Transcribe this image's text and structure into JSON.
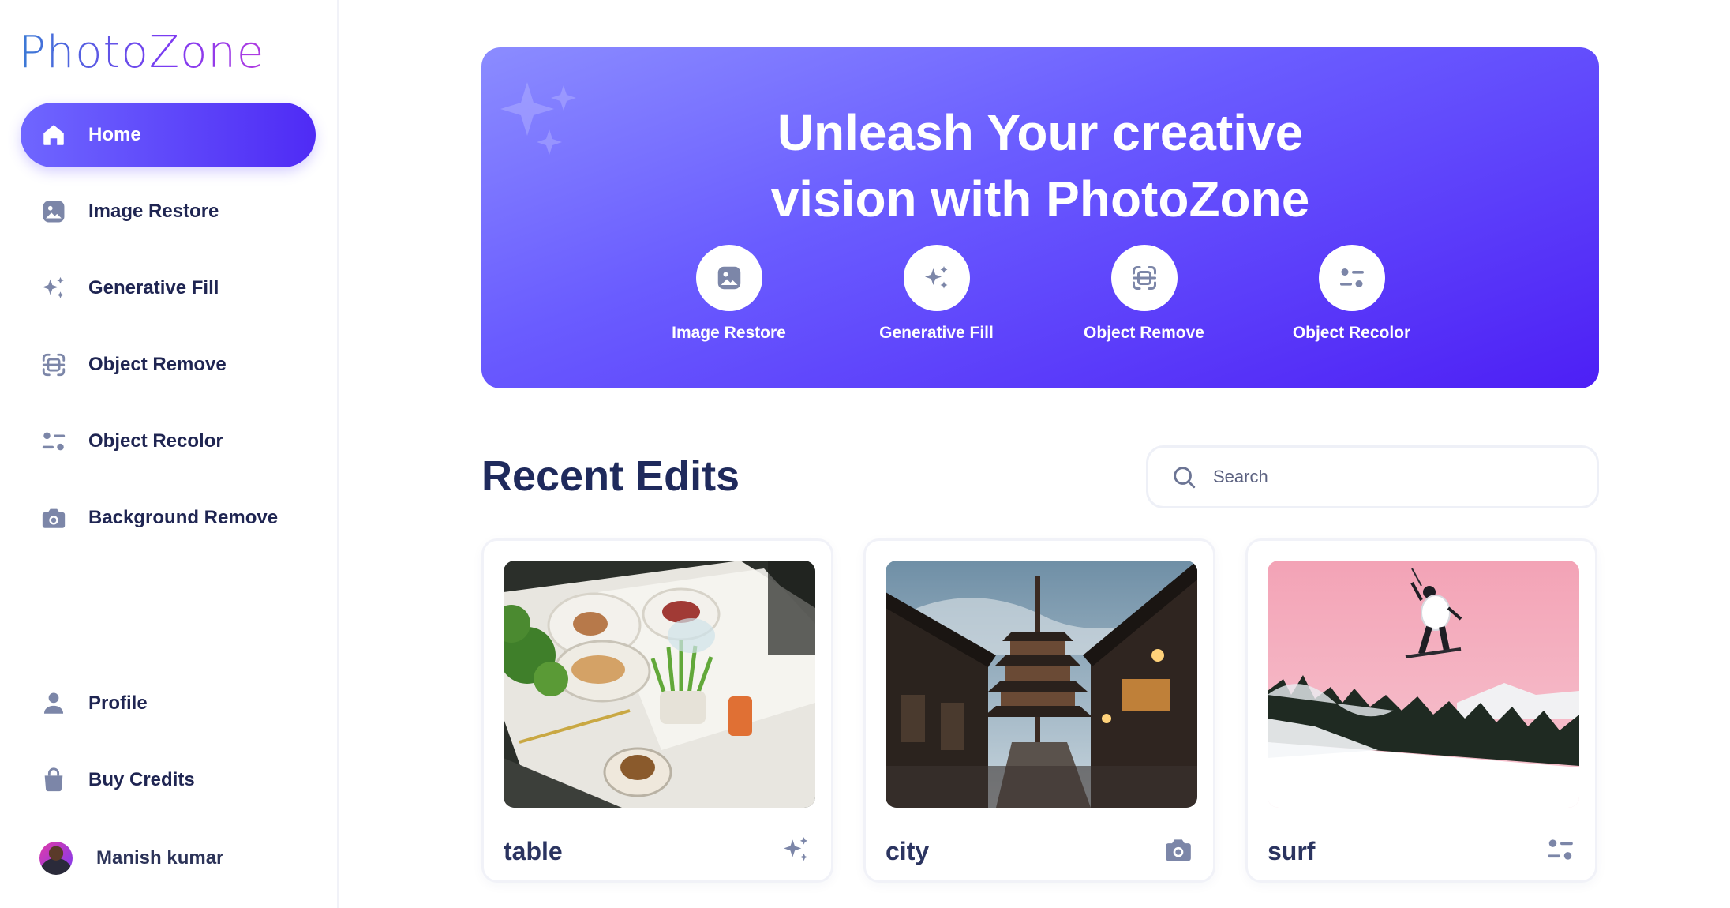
{
  "brand": {
    "logo": "PhotoZone"
  },
  "sidebar": {
    "items": [
      {
        "label": "Home",
        "icon": "home-icon",
        "active": true
      },
      {
        "label": "Image Restore",
        "icon": "image-icon"
      },
      {
        "label": "Generative Fill",
        "icon": "sparkles-icon"
      },
      {
        "label": "Object Remove",
        "icon": "scan-icon"
      },
      {
        "label": "Object Recolor",
        "icon": "filter-icon"
      },
      {
        "label": "Background Remove",
        "icon": "camera-icon"
      }
    ],
    "bottom_items": [
      {
        "label": "Profile",
        "icon": "user-icon"
      },
      {
        "label": "Buy Credits",
        "icon": "bag-icon"
      }
    ],
    "user": {
      "name": "Manish kumar"
    }
  },
  "hero": {
    "title_line1": "Unleash Your creative",
    "title_line2": "vision with PhotoZone",
    "tools": [
      {
        "label": "Image Restore",
        "icon": "image-icon"
      },
      {
        "label": "Generative Fill",
        "icon": "sparkles-icon"
      },
      {
        "label": "Object Remove",
        "icon": "scan-icon"
      },
      {
        "label": "Object Recolor",
        "icon": "filter-icon"
      }
    ]
  },
  "recent": {
    "title": "Recent Edits",
    "search_placeholder": "Search",
    "cards": [
      {
        "title": "table",
        "icon": "sparkles-icon"
      },
      {
        "title": "city",
        "icon": "camera-icon"
      },
      {
        "title": "surf",
        "icon": "filter-icon"
      }
    ]
  },
  "colors": {
    "accent": "#5b3cf7",
    "icon": "#7c86a8",
    "text": "#1f2552"
  }
}
